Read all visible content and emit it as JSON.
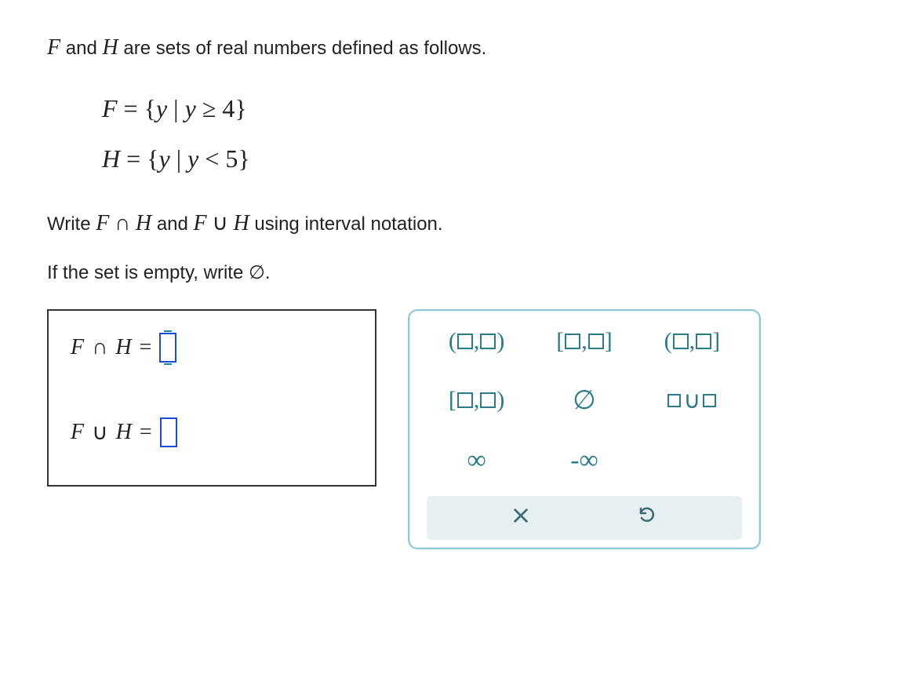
{
  "prompt": {
    "line1_pre": "",
    "F": "F",
    "and_word": " and ",
    "H": "H",
    "line1_post": " are sets of real numbers defined as follows.",
    "def_F": "F = { y | y ≥ 4 }",
    "def_H": "H = { y | y < 5 }",
    "line2_pre": "Write ",
    "intersect_expr": "F ∩ H",
    "and_word2": " and ",
    "union_expr": "F ∪ H",
    "line2_post": " using interval notation.",
    "line3": "If the set is empty, write ∅."
  },
  "answers": {
    "intersection_label_F": "F",
    "intersection_op": "∩",
    "intersection_label_H": "H",
    "eq": "=",
    "union_label_F": "F",
    "union_op": "∪",
    "union_label_H": "H"
  },
  "palette": {
    "open_open": "(□,□)",
    "closed_closed": "[□,□]",
    "open_closed": "(□,□]",
    "closed_open": "[□,□)",
    "empty_set": "∅",
    "union_template": "□∪□",
    "infinity": "∞",
    "neg_infinity": "-∞",
    "clear": "×",
    "undo": "↺"
  }
}
